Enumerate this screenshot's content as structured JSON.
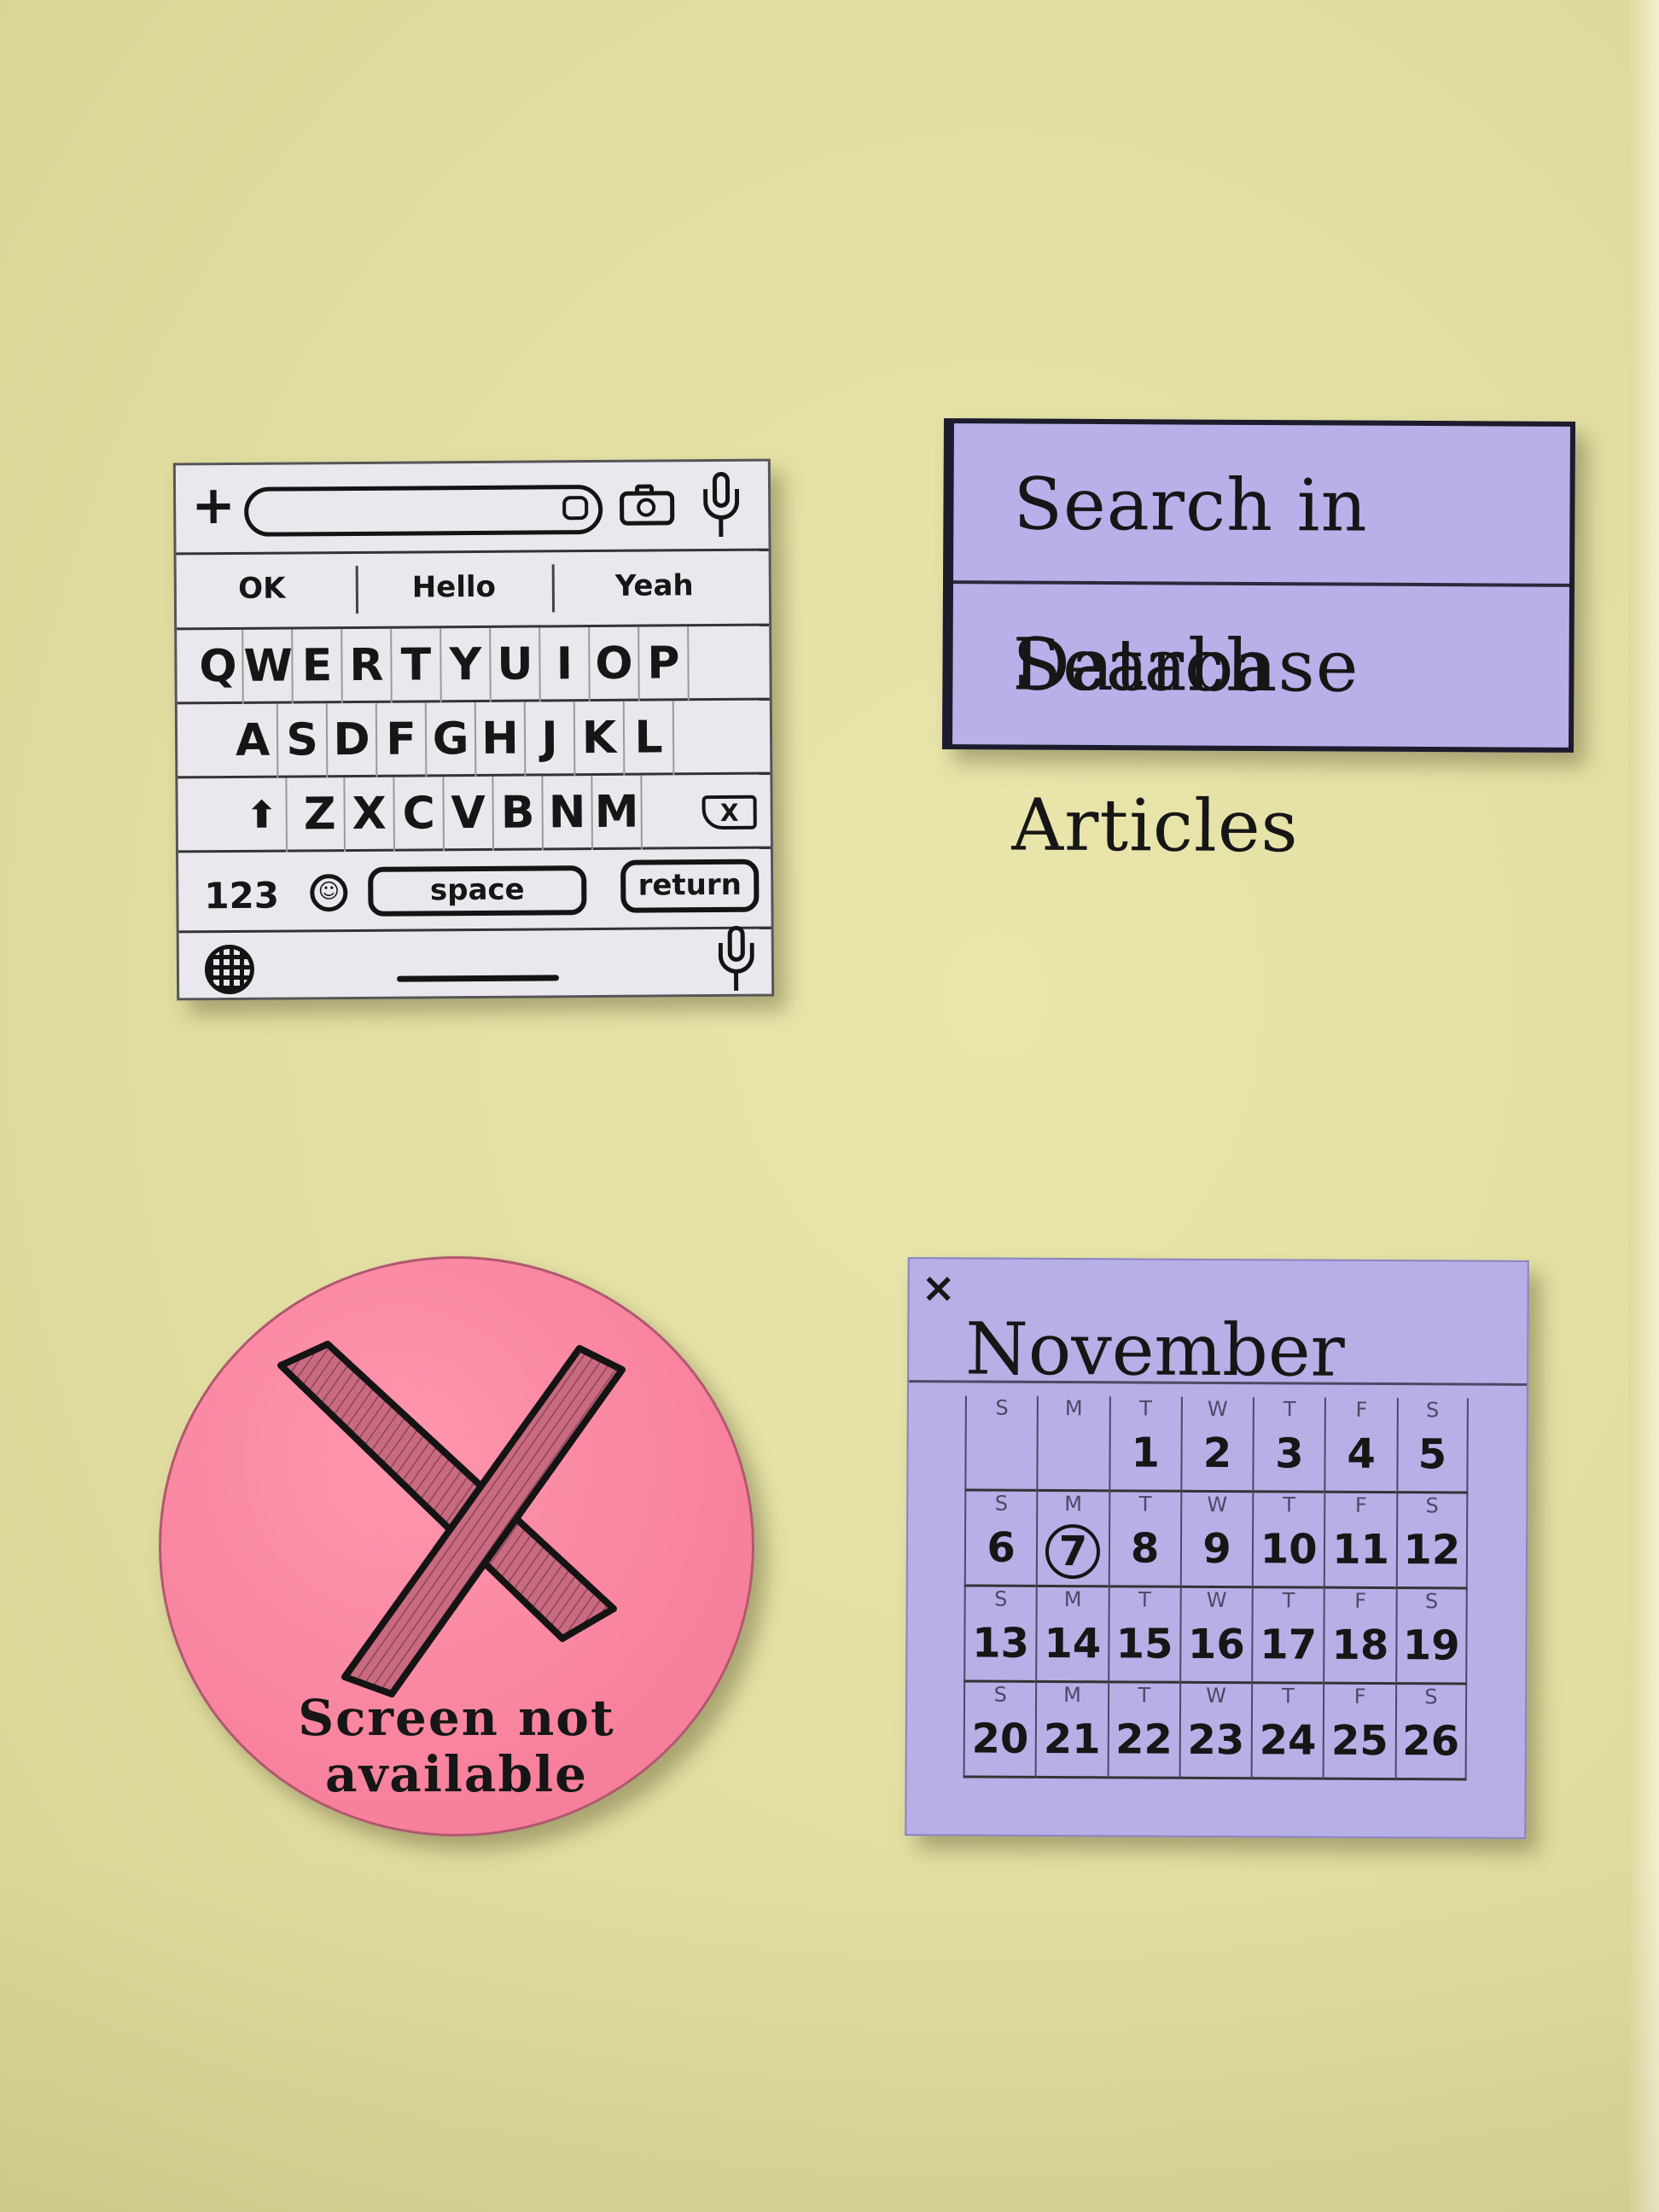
{
  "keyboard": {
    "plus": "+",
    "suggestions": [
      "OK",
      "Hello",
      "Yeah"
    ],
    "rows": [
      [
        "Q",
        "W",
        "E",
        "R",
        "T",
        "Y",
        "U",
        "I",
        "O",
        "P"
      ],
      [
        "A",
        "S",
        "D",
        "F",
        "G",
        "H",
        "J",
        "K",
        "L"
      ],
      [
        "Z",
        "X",
        "C",
        "V",
        "B",
        "N",
        "M"
      ]
    ],
    "shift": "⬆",
    "delete": "X",
    "numbers": "123",
    "emoji": "☺",
    "space": "space",
    "return": "return"
  },
  "search_menu": {
    "items": [
      "Search in Database",
      "Search Articles"
    ]
  },
  "unavailable": {
    "line1": "Screen not",
    "line2": "available"
  },
  "calendar": {
    "close": "×",
    "month": "November",
    "weekdays": [
      "S",
      "M",
      "T",
      "W",
      "T",
      "F",
      "S"
    ],
    "weeks": [
      [
        "",
        "",
        "1",
        "2",
        "3",
        "4",
        "5"
      ],
      [
        "6",
        "7",
        "8",
        "9",
        "10",
        "11",
        "12"
      ],
      [
        "13",
        "14",
        "15",
        "16",
        "17",
        "18",
        "19"
      ],
      [
        "20",
        "21",
        "22",
        "23",
        "24",
        "25",
        "26"
      ]
    ],
    "selected": "7"
  },
  "colors": {
    "wall": "#e2dea2",
    "keyboard_paper": "#eae8ee",
    "menu_paper": "#b9b0ea",
    "disc": "#f7809c",
    "calendar_paper": "#b7afe6"
  },
  "icons": [
    "plus-icon",
    "sticker-icon",
    "camera-icon",
    "microphone-icon",
    "globe-icon",
    "emoji-icon",
    "delete-icon",
    "shift-icon",
    "x-icon",
    "close-icon"
  ]
}
